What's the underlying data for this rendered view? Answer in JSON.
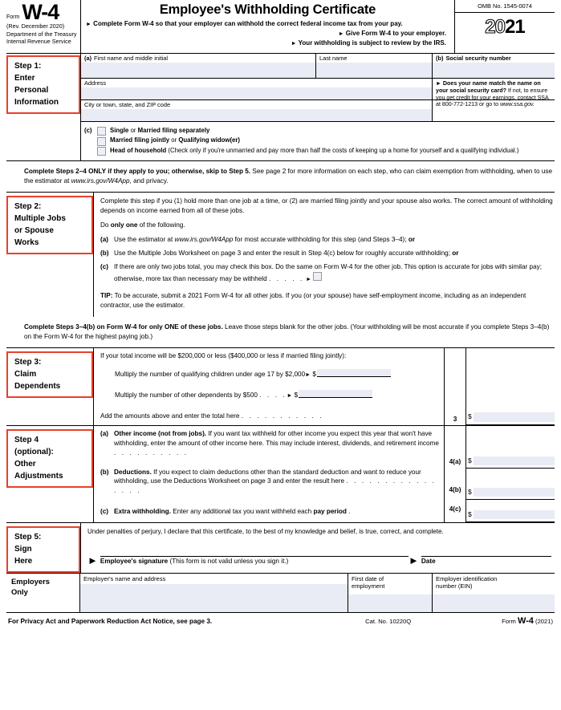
{
  "form": {
    "form_word": "Form",
    "number": "W-4",
    "revision": "(Rev. December 2020)",
    "dept_line1": "Department of the Treasury",
    "dept_line2": "Internal Revenue Service",
    "title": "Employee's Withholding Certificate",
    "bullets": [
      "Complete Form W-4 so that your employer can withhold the correct federal income tax from your pay.",
      "Give Form W-4 to your employer.",
      "Your withholding is subject to review by the IRS."
    ],
    "omb": "OMB No. 1545-0074",
    "year_outline": "20",
    "year_solid": "21"
  },
  "step1": {
    "label": "Step 1:\nEnter Personal Information",
    "label_lines": [
      "Step 1:",
      "Enter",
      "Personal",
      "Information"
    ],
    "marker_a": "(a)",
    "first_name_label": "First name and middle initial",
    "last_name_label": "Last name",
    "marker_b": "(b)",
    "ssn_label": "Social security number",
    "address_label": "Address",
    "city_label": "City or town, state, and ZIP code",
    "ssa_note_bold": "Does your name match the name on your social security card?",
    "ssa_note_rest": " If not, to ensure you get credit for your earnings, contact SSA at 800-772-1213 or go to ",
    "ssa_note_url": "www.ssa.gov.",
    "marker_c": "(c)",
    "filing_status": [
      {
        "bold": "Single",
        "mid": " or ",
        "bold2": "Married filing separately",
        "rest": ""
      },
      {
        "bold": "Married filing jointly",
        "mid": " or ",
        "bold2": "Qualifying widow(er)",
        "rest": ""
      },
      {
        "bold": "Head of household",
        "mid": "",
        "bold2": "",
        "rest": " (Check only if you're unmarried and pay more than half the costs of keeping up a home for yourself and a qualifying individual.)"
      }
    ]
  },
  "notice_2_4": {
    "bold": "Complete Steps 2–4 ONLY if they apply to you; otherwise, skip to Step 5.",
    "rest": " See page 2 for more information on each step, who can claim exemption from withholding, when to use the estimator at ",
    "url": "www.irs.gov/W4App",
    "tail": ", and privacy."
  },
  "step2": {
    "label_lines": [
      "Step 2:",
      "Multiple Jobs",
      "or Spouse",
      "Works"
    ],
    "intro": "Complete this step if you (1) hold more than one job at a time, or (2) are married filing jointly and your spouse also works. The correct amount of withholding depends on income earned from all of these jobs.",
    "do_one_pre": "Do ",
    "do_one_bold": "only one",
    "do_one_post": " of the following.",
    "items": [
      {
        "mk": "(a)",
        "pre": "Use the estimator at ",
        "url": "www.irs.gov/W4App",
        "post": " for most accurate withholding for this step (and Steps 3–4); ",
        "tail_bold": "or"
      },
      {
        "mk": "(b)",
        "pre": "Use the Multiple Jobs Worksheet on page 3 and enter the result in Step 4(c) below for roughly accurate withholding; ",
        "url": "",
        "post": "",
        "tail_bold": "or"
      },
      {
        "mk": "(c)",
        "pre": "If there are only two jobs total, you may check this box. Do the same on Form W-4 for the other job. This option is accurate for jobs with similar pay; otherwise, more tax than necessary may be withheld",
        "url": "",
        "post": "",
        "tail_bold": ""
      }
    ],
    "dots": ".    .    .    .    .",
    "tip_bold": "TIP:",
    "tip_rest": " To be accurate, submit a 2021 Form W-4 for all other jobs. If you (or your spouse) have self-employment income, including as an independent contractor, use the estimator."
  },
  "notice_3_4b": {
    "bold": "Complete Steps 3–4(b) on Form W-4 for only ONE of these jobs.",
    "rest": " Leave those steps blank for the other jobs. (Your withholding will be most accurate if you complete Steps 3–4(b) on the Form W-4 for the highest paying job.)"
  },
  "step3": {
    "label_lines": [
      "Step 3:",
      "Claim",
      "Dependents"
    ],
    "intro": "If your total income will be $200,000 or less ($400,000 or less if married filing jointly):",
    "line_children": "Multiply the number of qualifying children under age 17 by $2,000",
    "line_other": "Multiply the number of other dependents by $500",
    "line_other_dots": ".    .    .    .",
    "line_total": "Add the amounts above and enter the total here",
    "line_total_dots": ".     .     .     .     .     .     .     .     .     .     .",
    "code_3": "3",
    "dollar": "$"
  },
  "step4": {
    "label_lines": [
      "Step 4",
      "(optional):",
      "Other",
      "Adjustments"
    ],
    "a": {
      "mk": "(a)",
      "bold": "Other income (not from jobs).",
      "rest": " If you want tax withheld for other income you expect this year that won't have withholding, enter the amount of other income here. This may include interest, dividends, and retirement income",
      "dots": ".     .     .     .     .     .     .     .     .     .",
      "code": "4(a)"
    },
    "b": {
      "mk": "(b)",
      "bold": "Deductions.",
      "rest": " If you expect to claim deductions other than the standard deduction and want to reduce your withholding, use the Deductions Worksheet on page 3 and enter the result here",
      "dots": ".    .    .    .    .    .    .    .    .    .    .    .    .    .    .    .",
      "code": "4(b)"
    },
    "c": {
      "mk": "(c)",
      "bold": "Extra withholding.",
      "rest": " Enter any additional tax you want withheld each ",
      "bold2": "pay period",
      "dots": ".",
      "code": "4(c)"
    },
    "dollar": "$"
  },
  "step5": {
    "label_lines": [
      "Step 5:",
      "Sign",
      "Here"
    ],
    "perjury": "Under penalties of perjury, I declare that this certificate, to the best of my knowledge and belief, is true, correct, and complete.",
    "sig_bold": "Employee's signature",
    "sig_rest": " (This form is not valid unless you sign it.)",
    "date_label": "Date"
  },
  "employer": {
    "label_lines": [
      "Employers",
      "Only"
    ],
    "name_label": "Employer's name and address",
    "date_label_l1": "First date of",
    "date_label_l2": "employment",
    "ein_label_l1": "Employer identification",
    "ein_label_l2": "number (EIN)"
  },
  "footer": {
    "left": "For Privacy Act and Paperwork Reduction Act Notice, see page 3.",
    "center": "Cat. No. 10220Q",
    "right_form": "Form ",
    "right_w4": "W-4",
    "right_year": " (2021)"
  },
  "colors": {
    "step_border": "#e8402a",
    "field_fill": "#e9ebf5",
    "rule": "#000000"
  }
}
